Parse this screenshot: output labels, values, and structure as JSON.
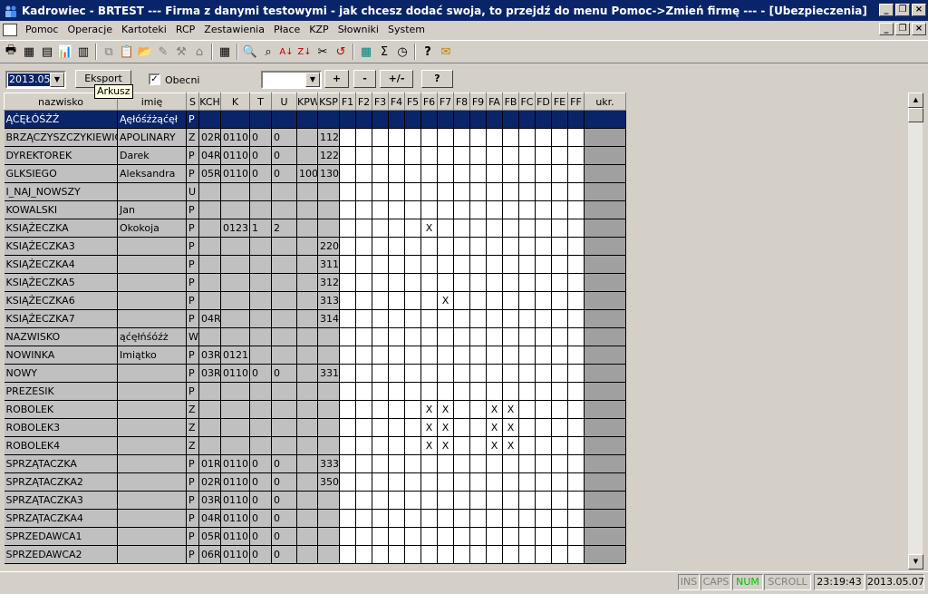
{
  "window": {
    "title": "Kadrowiec - BRTEST    ---   Firma z danymi testowymi - jak chcesz dodać swoja, to przejdź do menu Pomoc->Zmień firmę   --- - [Ubezpieczenia]"
  },
  "menu": [
    "Pomoc",
    "Operacje",
    "Kartoteki",
    "RCP",
    "Zestawienia",
    "Płace",
    "KZP",
    "Słowniki",
    "System"
  ],
  "filter": {
    "period": "2013.05",
    "export_label": "Eksport",
    "tooltip": "Arkusz",
    "obecni_label": "Obecni",
    "obecni_checked": "✓",
    "combo2_value": "",
    "plus_label": "+",
    "minus_label": "-",
    "plusminus_label": "+/-",
    "question_label": "?"
  },
  "columns": [
    "nazwisko",
    "imię",
    "S",
    "KCH",
    "K",
    "T",
    "U",
    "KPW",
    "KSP",
    "F1",
    "F2",
    "F3",
    "F4",
    "F5",
    "F6",
    "F7",
    "F8",
    "F9",
    "FA",
    "FB",
    "FC",
    "FD",
    "FE",
    "FF",
    "ukr."
  ],
  "rows": [
    {
      "nazwisko": "ĄĆĘŁÓŚŻŹ",
      "imie": "Ąęłóśźżąćęł",
      "s": "P",
      "kch": "",
      "k": "",
      "t": "",
      "u": "",
      "kpw": "",
      "ksp": "",
      "f": [
        "",
        "",
        "",
        "",
        "",
        "",
        "",
        "",
        "",
        "",
        "",
        "",
        "",
        "",
        ""
      ]
    },
    {
      "nazwisko": "BRZĄCZYSZCZYKIEWICZ",
      "imie": "APOLINARY",
      "s": "Z",
      "kch": "02R",
      "k": "0110",
      "t": "0",
      "u": "0",
      "kpw": "",
      "ksp": "112",
      "f": [
        "",
        "",
        "",
        "",
        "",
        "",
        "",
        "",
        "",
        "",
        "",
        "",
        "",
        "",
        ""
      ]
    },
    {
      "nazwisko": "DYREKTOREK",
      "imie": "Darek",
      "s": "P",
      "kch": "04R",
      "k": "0110",
      "t": "0",
      "u": "0",
      "kpw": "",
      "ksp": "122",
      "f": [
        "",
        "",
        "",
        "",
        "",
        "",
        "",
        "",
        "",
        "",
        "",
        "",
        "",
        "",
        ""
      ]
    },
    {
      "nazwisko": "GLKSIEGO",
      "imie": "Aleksandra",
      "s": "P",
      "kch": "05R",
      "k": "0110",
      "t": "0",
      "u": "0",
      "kpw": "100",
      "ksp": "130",
      "f": [
        "",
        "",
        "",
        "",
        "",
        "",
        "",
        "",
        "",
        "",
        "",
        "",
        "",
        "",
        ""
      ]
    },
    {
      "nazwisko": "I_NAJ_NOWSZY",
      "imie": "",
      "s": "U",
      "kch": "",
      "k": "",
      "t": "",
      "u": "",
      "kpw": "",
      "ksp": "",
      "f": [
        "",
        "",
        "",
        "",
        "",
        "",
        "",
        "",
        "",
        "",
        "",
        "",
        "",
        "",
        ""
      ]
    },
    {
      "nazwisko": "KOWALSKI",
      "imie": "Jan",
      "s": "P",
      "kch": "",
      "k": "",
      "t": "",
      "u": "",
      "kpw": "",
      "ksp": "",
      "f": [
        "",
        "",
        "",
        "",
        "",
        "",
        "",
        "",
        "",
        "",
        "",
        "",
        "",
        "",
        ""
      ]
    },
    {
      "nazwisko": "KSIĄŻECZKA",
      "imie": "Okokoja",
      "s": "P",
      "kch": "",
      "k": "0123",
      "t": "1",
      "u": "2",
      "kpw": "",
      "ksp": "",
      "f": [
        "",
        "",
        "",
        "",
        "",
        "X",
        "",
        "",
        "",
        "",
        "",
        "",
        "",
        "",
        ""
      ]
    },
    {
      "nazwisko": "KSIĄŻECZKA3",
      "imie": "",
      "s": "P",
      "kch": "",
      "k": "",
      "t": "",
      "u": "",
      "kpw": "",
      "ksp": "220",
      "f": [
        "",
        "",
        "",
        "",
        "",
        "",
        "",
        "",
        "",
        "",
        "",
        "",
        "",
        "",
        ""
      ]
    },
    {
      "nazwisko": "KSIĄŻECZKA4",
      "imie": "",
      "s": "P",
      "kch": "",
      "k": "",
      "t": "",
      "u": "",
      "kpw": "",
      "ksp": "311",
      "f": [
        "",
        "",
        "",
        "",
        "",
        "",
        "",
        "",
        "",
        "",
        "",
        "",
        "",
        "",
        ""
      ]
    },
    {
      "nazwisko": "KSIĄŻECZKA5",
      "imie": "",
      "s": "P",
      "kch": "",
      "k": "",
      "t": "",
      "u": "",
      "kpw": "",
      "ksp": "312",
      "f": [
        "",
        "",
        "",
        "",
        "",
        "",
        "",
        "",
        "",
        "",
        "",
        "",
        "",
        "",
        ""
      ]
    },
    {
      "nazwisko": "KSIĄŻECZKA6",
      "imie": "",
      "s": "P",
      "kch": "",
      "k": "",
      "t": "",
      "u": "",
      "kpw": "",
      "ksp": "313",
      "f": [
        "",
        "",
        "",
        "",
        "",
        "",
        "X",
        "",
        "",
        "",
        "",
        "",
        "",
        "",
        ""
      ]
    },
    {
      "nazwisko": "KSIĄŻECZKA7",
      "imie": "",
      "s": "P",
      "kch": "04R",
      "k": "",
      "t": "",
      "u": "",
      "kpw": "",
      "ksp": "314",
      "f": [
        "",
        "",
        "",
        "",
        "",
        "",
        "",
        "",
        "",
        "",
        "",
        "",
        "",
        "",
        ""
      ]
    },
    {
      "nazwisko": "NAZWISKO",
      "imie": "ąćęłńśóźż",
      "s": "W",
      "kch": "",
      "k": "",
      "t": "",
      "u": "",
      "kpw": "",
      "ksp": "",
      "f": [
        "",
        "",
        "",
        "",
        "",
        "",
        "",
        "",
        "",
        "",
        "",
        "",
        "",
        "",
        ""
      ]
    },
    {
      "nazwisko": "NOWINKA",
      "imie": "Imiątko",
      "s": "P",
      "kch": "03R",
      "k": "0121",
      "t": "",
      "u": "",
      "kpw": "",
      "ksp": "",
      "f": [
        "",
        "",
        "",
        "",
        "",
        "",
        "",
        "",
        "",
        "",
        "",
        "",
        "",
        "",
        ""
      ]
    },
    {
      "nazwisko": "NOWY",
      "imie": "",
      "s": "P",
      "kch": "03R",
      "k": "0110",
      "t": "0",
      "u": "0",
      "kpw": "",
      "ksp": "331",
      "f": [
        "",
        "",
        "",
        "",
        "",
        "",
        "",
        "",
        "",
        "",
        "",
        "",
        "",
        "",
        ""
      ]
    },
    {
      "nazwisko": "PREZESIK",
      "imie": "",
      "s": "P",
      "kch": "",
      "k": "",
      "t": "",
      "u": "",
      "kpw": "",
      "ksp": "",
      "f": [
        "",
        "",
        "",
        "",
        "",
        "",
        "",
        "",
        "",
        "",
        "",
        "",
        "",
        "",
        ""
      ]
    },
    {
      "nazwisko": "ROBOLEK",
      "imie": "",
      "s": "Z",
      "kch": "",
      "k": "",
      "t": "",
      "u": "",
      "kpw": "",
      "ksp": "",
      "f": [
        "",
        "",
        "",
        "",
        "",
        "X",
        "X",
        "",
        "",
        "X",
        "X",
        "",
        "",
        "",
        ""
      ]
    },
    {
      "nazwisko": "ROBOLEK3",
      "imie": "",
      "s": "Z",
      "kch": "",
      "k": "",
      "t": "",
      "u": "",
      "kpw": "",
      "ksp": "",
      "f": [
        "",
        "",
        "",
        "",
        "",
        "X",
        "X",
        "",
        "",
        "X",
        "X",
        "",
        "",
        "",
        ""
      ]
    },
    {
      "nazwisko": "ROBOLEK4",
      "imie": "",
      "s": "Z",
      "kch": "",
      "k": "",
      "t": "",
      "u": "",
      "kpw": "",
      "ksp": "",
      "f": [
        "",
        "",
        "",
        "",
        "",
        "X",
        "X",
        "",
        "",
        "X",
        "X",
        "",
        "",
        "",
        ""
      ]
    },
    {
      "nazwisko": "SPRZĄTACZKA",
      "imie": "",
      "s": "P",
      "kch": "01R",
      "k": "0110",
      "t": "0",
      "u": "0",
      "kpw": "",
      "ksp": "333",
      "f": [
        "",
        "",
        "",
        "",
        "",
        "",
        "",
        "",
        "",
        "",
        "",
        "",
        "",
        "",
        ""
      ]
    },
    {
      "nazwisko": "SPRZĄTACZKA2",
      "imie": "",
      "s": "P",
      "kch": "02R",
      "k": "0110",
      "t": "0",
      "u": "0",
      "kpw": "",
      "ksp": "350",
      "f": [
        "",
        "",
        "",
        "",
        "",
        "",
        "",
        "",
        "",
        "",
        "",
        "",
        "",
        "",
        ""
      ]
    },
    {
      "nazwisko": "SPRZĄTACZKA3",
      "imie": "",
      "s": "P",
      "kch": "03R",
      "k": "0110",
      "t": "0",
      "u": "0",
      "kpw": "",
      "ksp": "",
      "f": [
        "",
        "",
        "",
        "",
        "",
        "",
        "",
        "",
        "",
        "",
        "",
        "",
        "",
        "",
        ""
      ]
    },
    {
      "nazwisko": "SPRZĄTACZKA4",
      "imie": "",
      "s": "P",
      "kch": "04R",
      "k": "0110",
      "t": "0",
      "u": "0",
      "kpw": "",
      "ksp": "",
      "f": [
        "",
        "",
        "",
        "",
        "",
        "",
        "",
        "",
        "",
        "",
        "",
        "",
        "",
        "",
        ""
      ]
    },
    {
      "nazwisko": "SPRZEDAWCA1",
      "imie": "",
      "s": "P",
      "kch": "05R",
      "k": "0110",
      "t": "0",
      "u": "0",
      "kpw": "",
      "ksp": "",
      "f": [
        "",
        "",
        "",
        "",
        "",
        "",
        "",
        "",
        "",
        "",
        "",
        "",
        "",
        "",
        ""
      ]
    },
    {
      "nazwisko": "SPRZEDAWCA2",
      "imie": "",
      "s": "P",
      "kch": "06R",
      "k": "0110",
      "t": "0",
      "u": "0",
      "kpw": "",
      "ksp": "",
      "f": [
        "",
        "",
        "",
        "",
        "",
        "",
        "",
        "",
        "",
        "",
        "",
        "",
        "",
        "",
        ""
      ]
    }
  ],
  "status": {
    "ins": "INS",
    "caps": "CAPS",
    "num": "NUM",
    "scroll": "SCROLL",
    "time": "23:19:43",
    "date": "2013.05.07",
    "active_color": "#00c000",
    "inactive_color": "#808080"
  }
}
